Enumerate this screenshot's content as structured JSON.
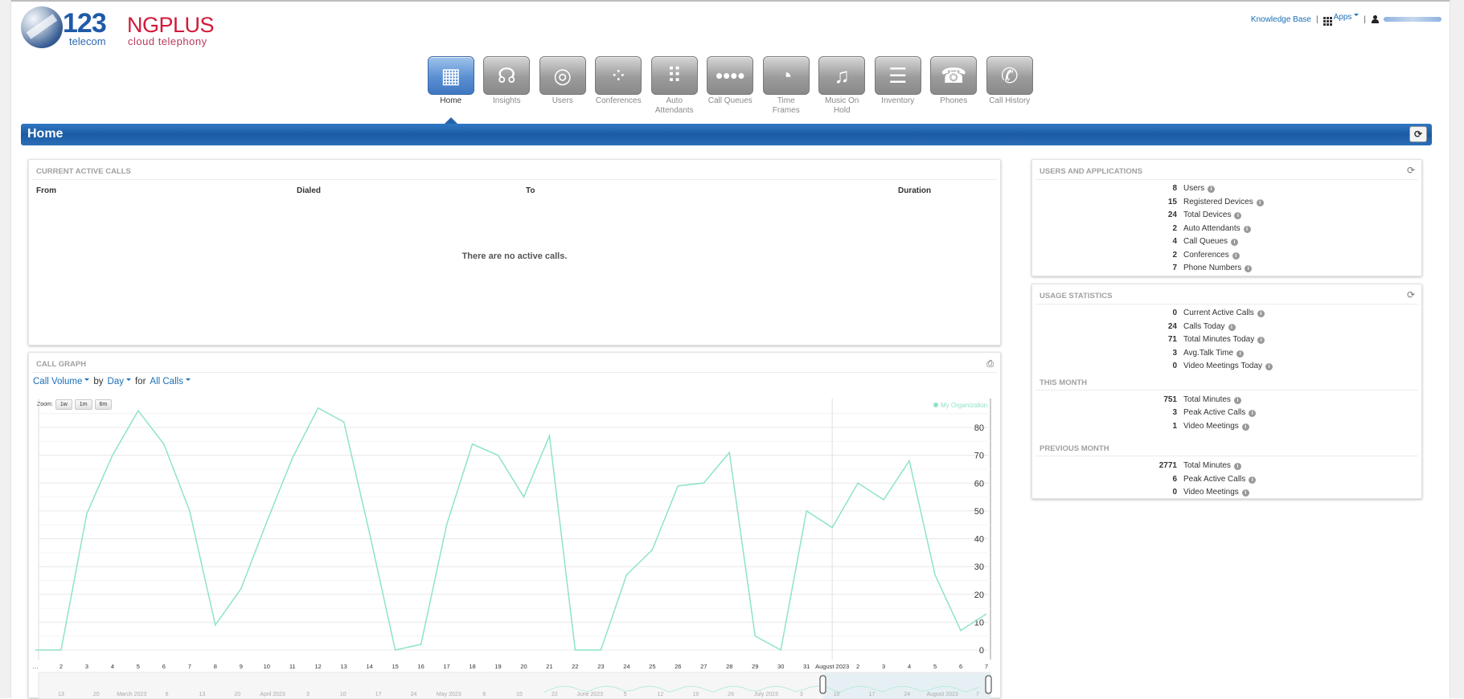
{
  "brand": {
    "number": "123",
    "sub": "telecom",
    "name": "NGPLUS",
    "tagline": "cloud telephony"
  },
  "top_links": {
    "knowledge_base": "Knowledge Base",
    "apps": "Apps",
    "separator": "|"
  },
  "nav": [
    {
      "label": "Home",
      "icon": "building-icon",
      "glyph": "▦",
      "active": true
    },
    {
      "label": "Insights",
      "icon": "headset-icon",
      "glyph": "☊",
      "active": false
    },
    {
      "label": "Users",
      "icon": "users-icon",
      "glyph": "◎",
      "active": false
    },
    {
      "label": "Conferences",
      "icon": "conference-icon",
      "glyph": "⁘",
      "active": false
    },
    {
      "label": "Auto Attendants",
      "icon": "keypad-icon",
      "glyph": "⠿",
      "active": false
    },
    {
      "label": "Call Queues",
      "icon": "queue-icon",
      "glyph": "••••",
      "active": false
    },
    {
      "label": "Time Frames",
      "icon": "clock-icon",
      "glyph": "◔",
      "active": false
    },
    {
      "label": "Music On Hold",
      "icon": "music-note-icon",
      "glyph": "♫",
      "active": false
    },
    {
      "label": "Inventory",
      "icon": "list-icon",
      "glyph": "☰",
      "active": false
    },
    {
      "label": "Phones",
      "icon": "handset-icon",
      "glyph": "☎",
      "active": false
    },
    {
      "label": "Call History",
      "icon": "call-history-icon",
      "glyph": "✆",
      "active": false
    }
  ],
  "page": {
    "title": "Home",
    "refresh_icon": "refresh-icon"
  },
  "active_calls": {
    "title": "CURRENT ACTIVE CALLS",
    "columns": [
      "From",
      "Dialed",
      "To",
      "Duration"
    ],
    "empty_message": "There are no active calls."
  },
  "call_graph": {
    "title": "CALL GRAPH",
    "metric": "Call Volume",
    "by_label": "by",
    "interval": "Day",
    "for_label": "for",
    "filter": "All Calls",
    "zoom_label": "Zoom:",
    "zoom_options": [
      "1w",
      "1m",
      "6m"
    ],
    "legend": "My Organization"
  },
  "chart_data": {
    "type": "line",
    "series": [
      {
        "name": "My Organization",
        "color": "#8ee3c8"
      }
    ],
    "x": [
      "…",
      "2",
      "3",
      "4",
      "5",
      "6",
      "7",
      "8",
      "9",
      "10",
      "11",
      "12",
      "13",
      "14",
      "15",
      "16",
      "17",
      "18",
      "19",
      "20",
      "21",
      "22",
      "23",
      "24",
      "25",
      "26",
      "27",
      "28",
      "29",
      "30",
      "31",
      "August 2023",
      "2",
      "3",
      "4",
      "5",
      "6",
      "7"
    ],
    "values": [
      0,
      0,
      49,
      70,
      86,
      74,
      50,
      9,
      22,
      46,
      69,
      87,
      82,
      42,
      0,
      2,
      45,
      74,
      70,
      55,
      77,
      0,
      0,
      27,
      36,
      59,
      60,
      71,
      5,
      0,
      50,
      44,
      60,
      54,
      68,
      27,
      7,
      13
    ],
    "ylim": [
      0,
      85
    ],
    "yticks": [
      0,
      10,
      20,
      30,
      40,
      50,
      60,
      70,
      80
    ],
    "grid": true,
    "y_axis_side": "right",
    "legend_position": "top-right",
    "navigator_labels": [
      "13",
      "20",
      "March 2023",
      "6",
      "13",
      "20",
      "April 2023",
      "3",
      "10",
      "17",
      "24",
      "May 2023",
      "8",
      "15",
      "22",
      "June 2023",
      "5",
      "12",
      "19",
      "26",
      "July 2023",
      "3",
      "10",
      "17",
      "24",
      "August 2023",
      "7"
    ]
  },
  "users_apps": {
    "title": "USERS AND APPLICATIONS",
    "rows": [
      {
        "value": "8",
        "label": "Users"
      },
      {
        "value": "15",
        "label": "Registered Devices"
      },
      {
        "value": "24",
        "label": "Total Devices"
      },
      {
        "value": "2",
        "label": "Auto Attendants"
      },
      {
        "value": "4",
        "label": "Call Queues"
      },
      {
        "value": "2",
        "label": "Conferences"
      },
      {
        "value": "7",
        "label": "Phone Numbers"
      }
    ]
  },
  "usage_stats": {
    "title": "USAGE STATISTICS",
    "rows": [
      {
        "value": "0",
        "label": "Current Active Calls"
      },
      {
        "value": "24",
        "label": "Calls Today"
      },
      {
        "value": "71",
        "label": "Total Minutes Today"
      },
      {
        "value": "3",
        "label": "Avg.Talk Time"
      },
      {
        "value": "0",
        "label": "Video Meetings Today"
      }
    ],
    "this_month_title": "THIS MONTH",
    "this_month": [
      {
        "value": "751",
        "label": "Total Minutes"
      },
      {
        "value": "3",
        "label": "Peak Active Calls"
      },
      {
        "value": "1",
        "label": "Video Meetings"
      }
    ],
    "previous_month_title": "PREVIOUS MONTH",
    "previous_month": [
      {
        "value": "2771",
        "label": "Total Minutes"
      },
      {
        "value": "6",
        "label": "Peak Active Calls"
      },
      {
        "value": "0",
        "label": "Video Meetings"
      }
    ]
  }
}
